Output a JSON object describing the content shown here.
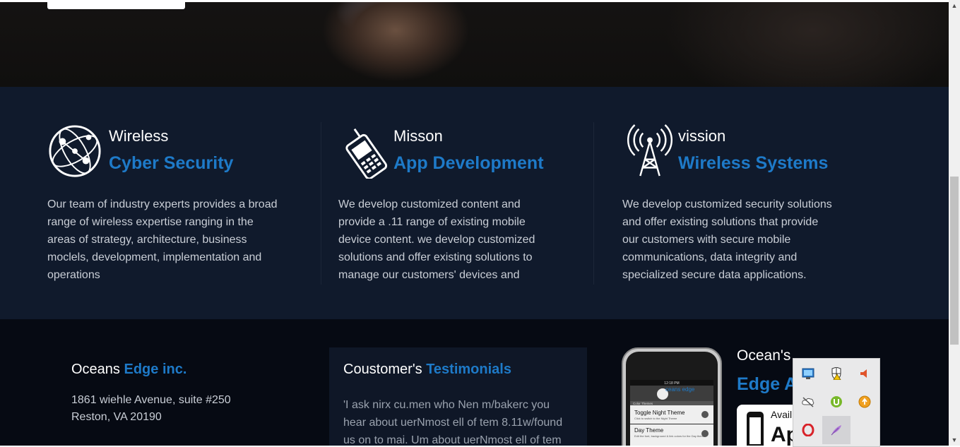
{
  "features": [
    {
      "small": "Wireless",
      "big": "Cyber Security",
      "icon": "globe-network-icon",
      "text": [
        "Our team of industry experts provides a broad",
        "range of wireless expertise ranging in the",
        "areas of strategy, architecture, business",
        "moclels, development, implementation and",
        "operations"
      ]
    },
    {
      "small": "Misson",
      "big": "App Development",
      "icon": "mobile-phone-icon",
      "text": [
        "We develop customized content and",
        "provide a .11 range of existing mobile",
        "device content. we develop customized",
        "solutions and offer existing solutions to",
        "manage our customers' devices and"
      ]
    },
    {
      "small": "vission",
      "big": "Wireless Systems",
      "icon": "radio-tower-icon",
      "text": [
        "We develop customized security solutions",
        "and offer existing solutions that provide",
        "our customers with secure mobile",
        "communications, data integrity and",
        "specialized secure data applications."
      ]
    }
  ],
  "address": {
    "title_white": "Oceans ",
    "title_blue": "Edge inc.",
    "lines": [
      "1861 wiehle Avenue, suite #250",
      "Reston, VA 20190"
    ]
  },
  "testimonials": {
    "title_white": "Coustomer's ",
    "title_blue": "Testimonials",
    "text": [
      "'I ask nirx cu.men who Nen m/bakerc you",
      "hear about uerNmost ell of tem 8.11w/found",
      "us on to mai. Um about uerNmost ell of tem"
    ]
  },
  "app": {
    "title_white": "Ocean's",
    "title_blue": "Edge A",
    "store_small": "Avail",
    "store_big": "Ap",
    "phone_screen": {
      "brand": "ceans edge",
      "list_header": "Color Themes",
      "items": [
        {
          "title": "Toggle Night Theme",
          "sub": "Click to switch to the Night Theme"
        },
        {
          "title": "Day Theme",
          "sub": "Edit the font, background & link colors for the Day theme"
        }
      ],
      "time": "12:18 PM"
    }
  },
  "tray": {
    "icons": [
      "network-monitor-icon",
      "shield-warning-icon",
      "speaker-icon",
      "cloud-offline-icon",
      "utorrent-icon",
      "update-icon",
      "opera-icon",
      "feather-icon"
    ]
  }
}
